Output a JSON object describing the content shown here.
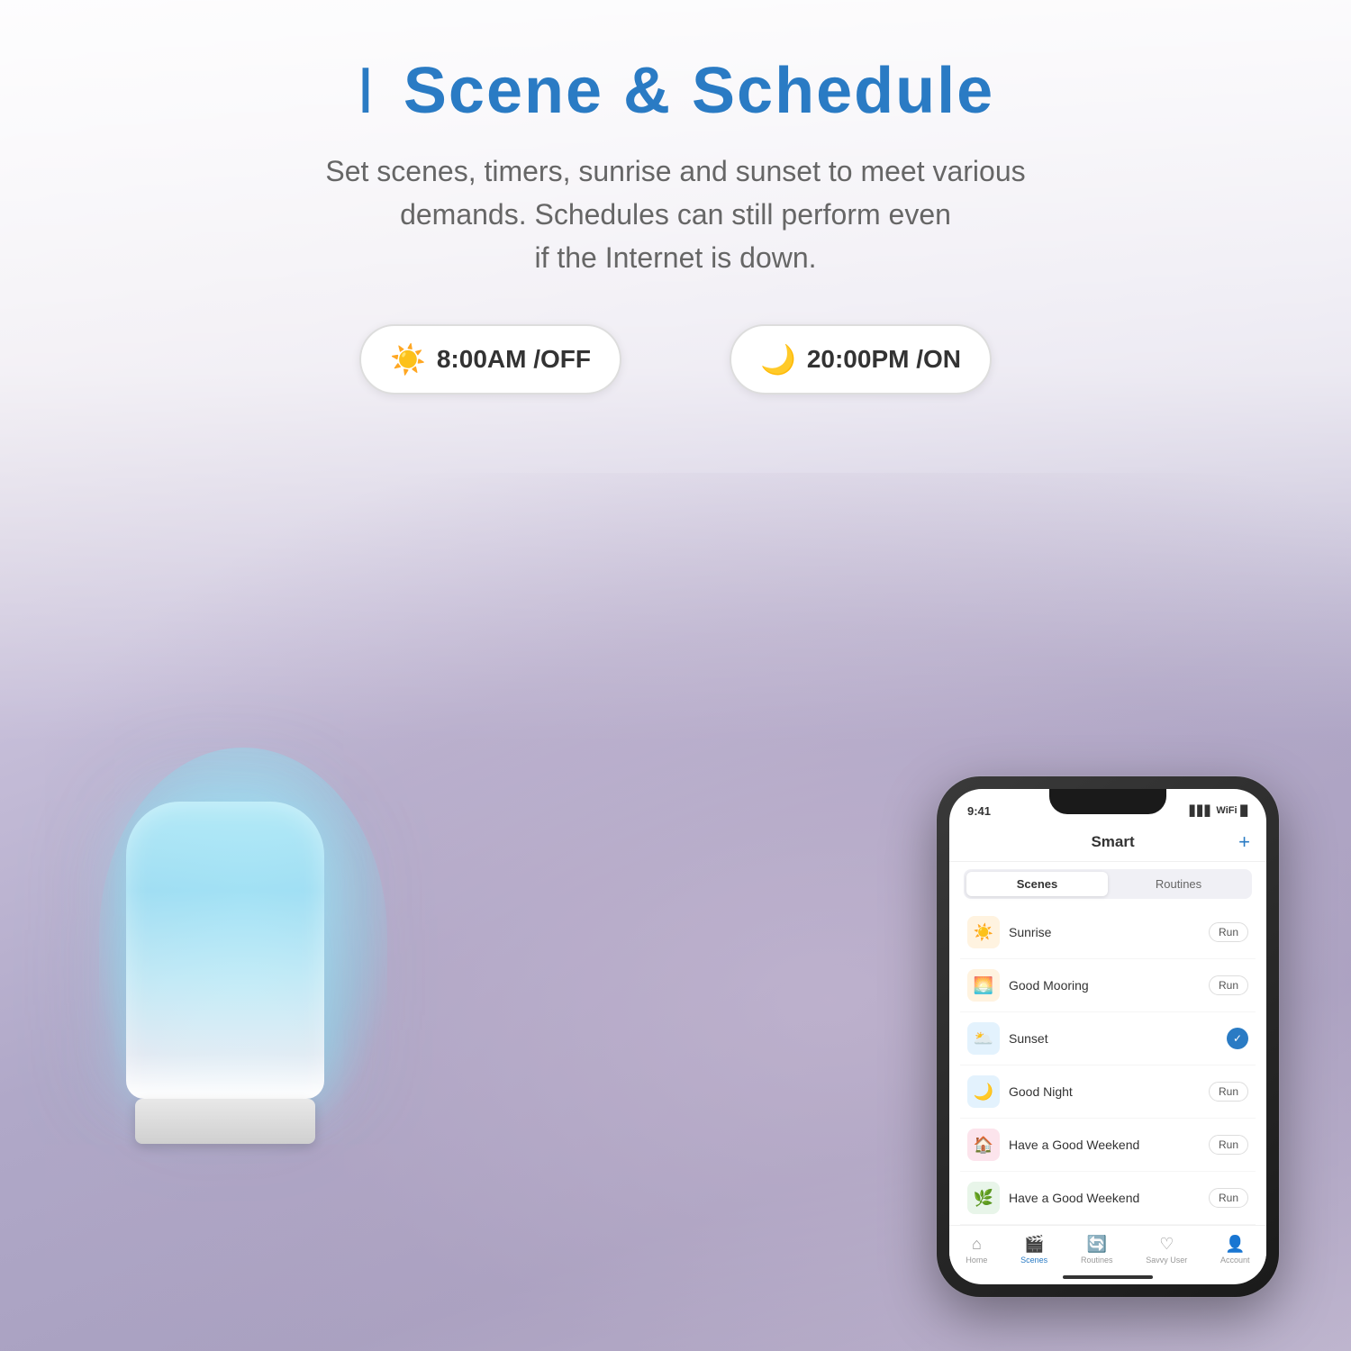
{
  "page": {
    "bg_color": "#f0eff4"
  },
  "header": {
    "title": "Scene & Schedule",
    "title_bar": "I",
    "subtitle_line1": "Set scenes, timers, sunrise and sunset to meet various",
    "subtitle_line2": "demands. Schedules can still perform even",
    "subtitle_line3": "if the Internet is down."
  },
  "schedules": [
    {
      "icon": "☀️",
      "time": "8:00AM",
      "separator": "/",
      "status": "OFF"
    },
    {
      "icon": "🌙",
      "time": "20:00PM",
      "separator": "/",
      "status": "ON"
    }
  ],
  "phone": {
    "status_time": "9:41",
    "status_signal": "▋▋▋",
    "status_wifi": "WiFi",
    "status_battery": "🔋",
    "app_title": "Smart",
    "plus_label": "+",
    "tabs": [
      {
        "label": "Scenes",
        "active": true
      },
      {
        "label": "Routines",
        "active": false
      }
    ],
    "scenes": [
      {
        "icon": "☀️",
        "icon_bg": "#fff3e0",
        "name": "Sunrise",
        "action": "Run"
      },
      {
        "icon": "🌅",
        "icon_bg": "#fff3e0",
        "name": "Good Mooring",
        "action": "Run"
      },
      {
        "icon": "🌥️",
        "icon_bg": "#e3f2fd",
        "name": "Sunset",
        "action": "check"
      },
      {
        "icon": "🌙",
        "icon_bg": "#e3f2fd",
        "name": "Good Night",
        "action": "Run"
      },
      {
        "icon": "🏠",
        "icon_bg": "#fce4ec",
        "name": "Have a Good Weekend",
        "action": "Run"
      },
      {
        "icon": "🌿",
        "icon_bg": "#e8f5e9",
        "name": "Have a Good Weekend",
        "action": "Run"
      }
    ],
    "nav_items": [
      {
        "icon": "🏠",
        "label": "Home",
        "active": false
      },
      {
        "icon": "🎬",
        "label": "Scenes",
        "active": true
      },
      {
        "icon": "🔄",
        "label": "Routines",
        "active": false
      },
      {
        "icon": "♡",
        "label": "Savvy User",
        "active": false
      },
      {
        "icon": "👤",
        "label": "Account",
        "active": false
      }
    ]
  }
}
